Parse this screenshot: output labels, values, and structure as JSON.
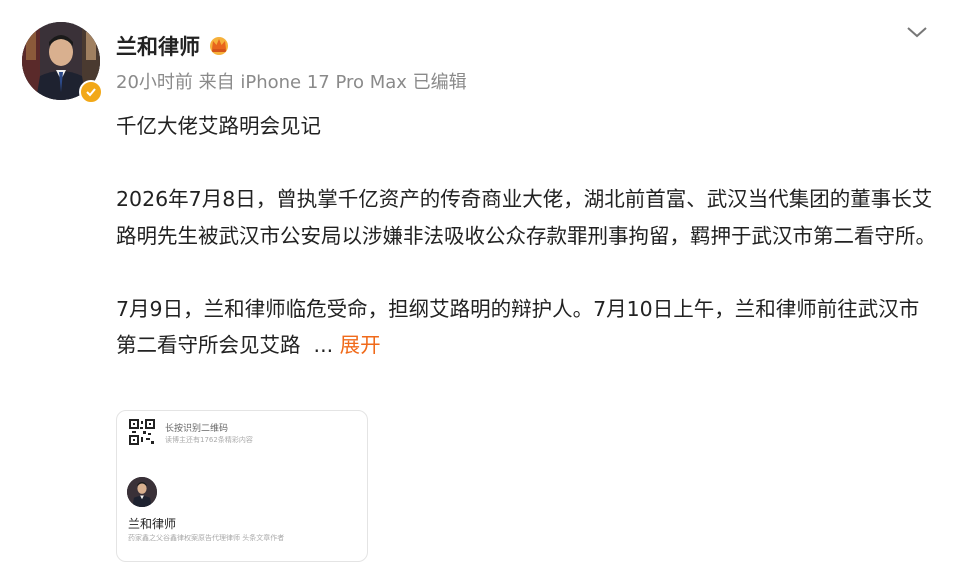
{
  "post": {
    "author": "兰和律师",
    "meta": "20小时前  来自 iPhone 17 Pro Max 已编辑",
    "title": "千亿大佬艾路明会见记",
    "paragraph1": "2026年7月8日，曾执掌千亿资产的传奇商业大佬，湖北前首富、武汉当代集团的董事长艾路明先生被武汉市公安局以涉嫌非法吸收公众存款罪刑事拘留，羁押于武汉市第二看守所。",
    "paragraph2_text": "7月9日，兰和律师临危受命，担纲艾路明的辩护人。7月10日上午，兰和律师前往武汉市第二看守所会见艾路",
    "ellipsis": "...",
    "expand_label": "展开"
  },
  "card": {
    "qr_title": "长按识别二维码",
    "qr_subtitle": "读博主还有1762条精彩内容",
    "name": "兰和律师",
    "description": "药家鑫之父谷鑫律权案原告代理律师 头条文章作者"
  },
  "icons": {
    "crown": "crown-icon",
    "verify": "verified-badge-icon",
    "collapse": "chevron-down-icon"
  },
  "colors": {
    "accent": "#f06a1a",
    "verify_badge": "#f2a818",
    "meta_text": "#8a8a8a"
  }
}
